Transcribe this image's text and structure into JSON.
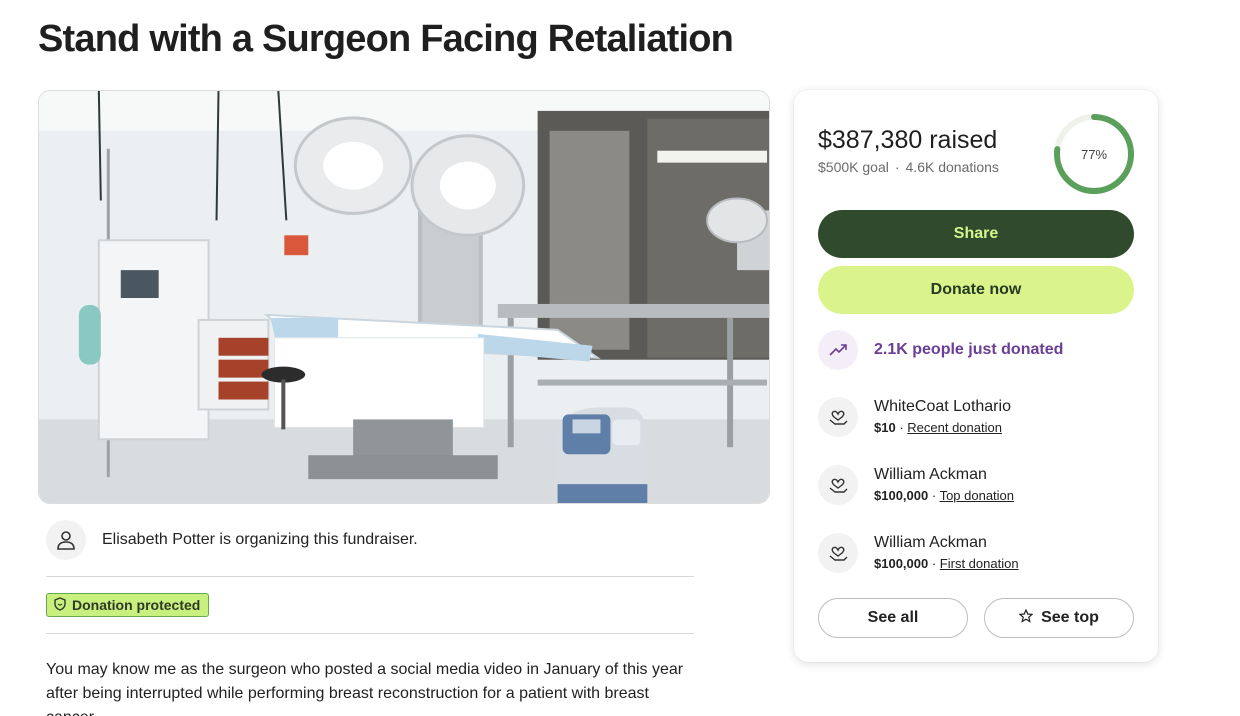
{
  "page": {
    "title": "Stand with a Surgeon Facing Retaliation"
  },
  "organizer": {
    "text": "Elisabeth Potter is organizing this fundraiser.",
    "icon": "person-icon"
  },
  "badge": {
    "label": "Donation protected",
    "icon": "shield-icon",
    "color": "#c9ef7f"
  },
  "story": {
    "text": "You may know me as the surgeon who posted a social media video in January of this year after being interrupted while performing breast reconstruction for a patient with breast cancer."
  },
  "donation_card": {
    "raised": "$387,380 raised",
    "goal": "$500K goal",
    "separator": "·",
    "donations": "4.6K donations",
    "progress_fraction": 0.77,
    "progress_label": "77%",
    "share_label": "Share",
    "donate_label": "Donate now",
    "trend": {
      "text": "2.1K people just donated",
      "icon": "trending-up-icon",
      "color": "#6b3e96"
    },
    "donors": [
      {
        "name": "WhiteCoat Lothario",
        "amount": "$10",
        "link": "Recent donation",
        "icon": "heart-hand-icon"
      },
      {
        "name": "William Ackman",
        "amount": "$100,000",
        "link": "Top donation",
        "icon": "heart-hand-icon"
      },
      {
        "name": "William Ackman",
        "amount": "$100,000",
        "link": "First donation",
        "icon": "heart-hand-icon"
      }
    ],
    "see_all_label": "See all",
    "see_top_label": "See top",
    "see_top_icon": "star-icon"
  },
  "colors": {
    "share_bg": "#2f4a2d",
    "share_text": "#d4f68c",
    "donate_bg": "#daf48b",
    "progress": "#5aa05a"
  }
}
